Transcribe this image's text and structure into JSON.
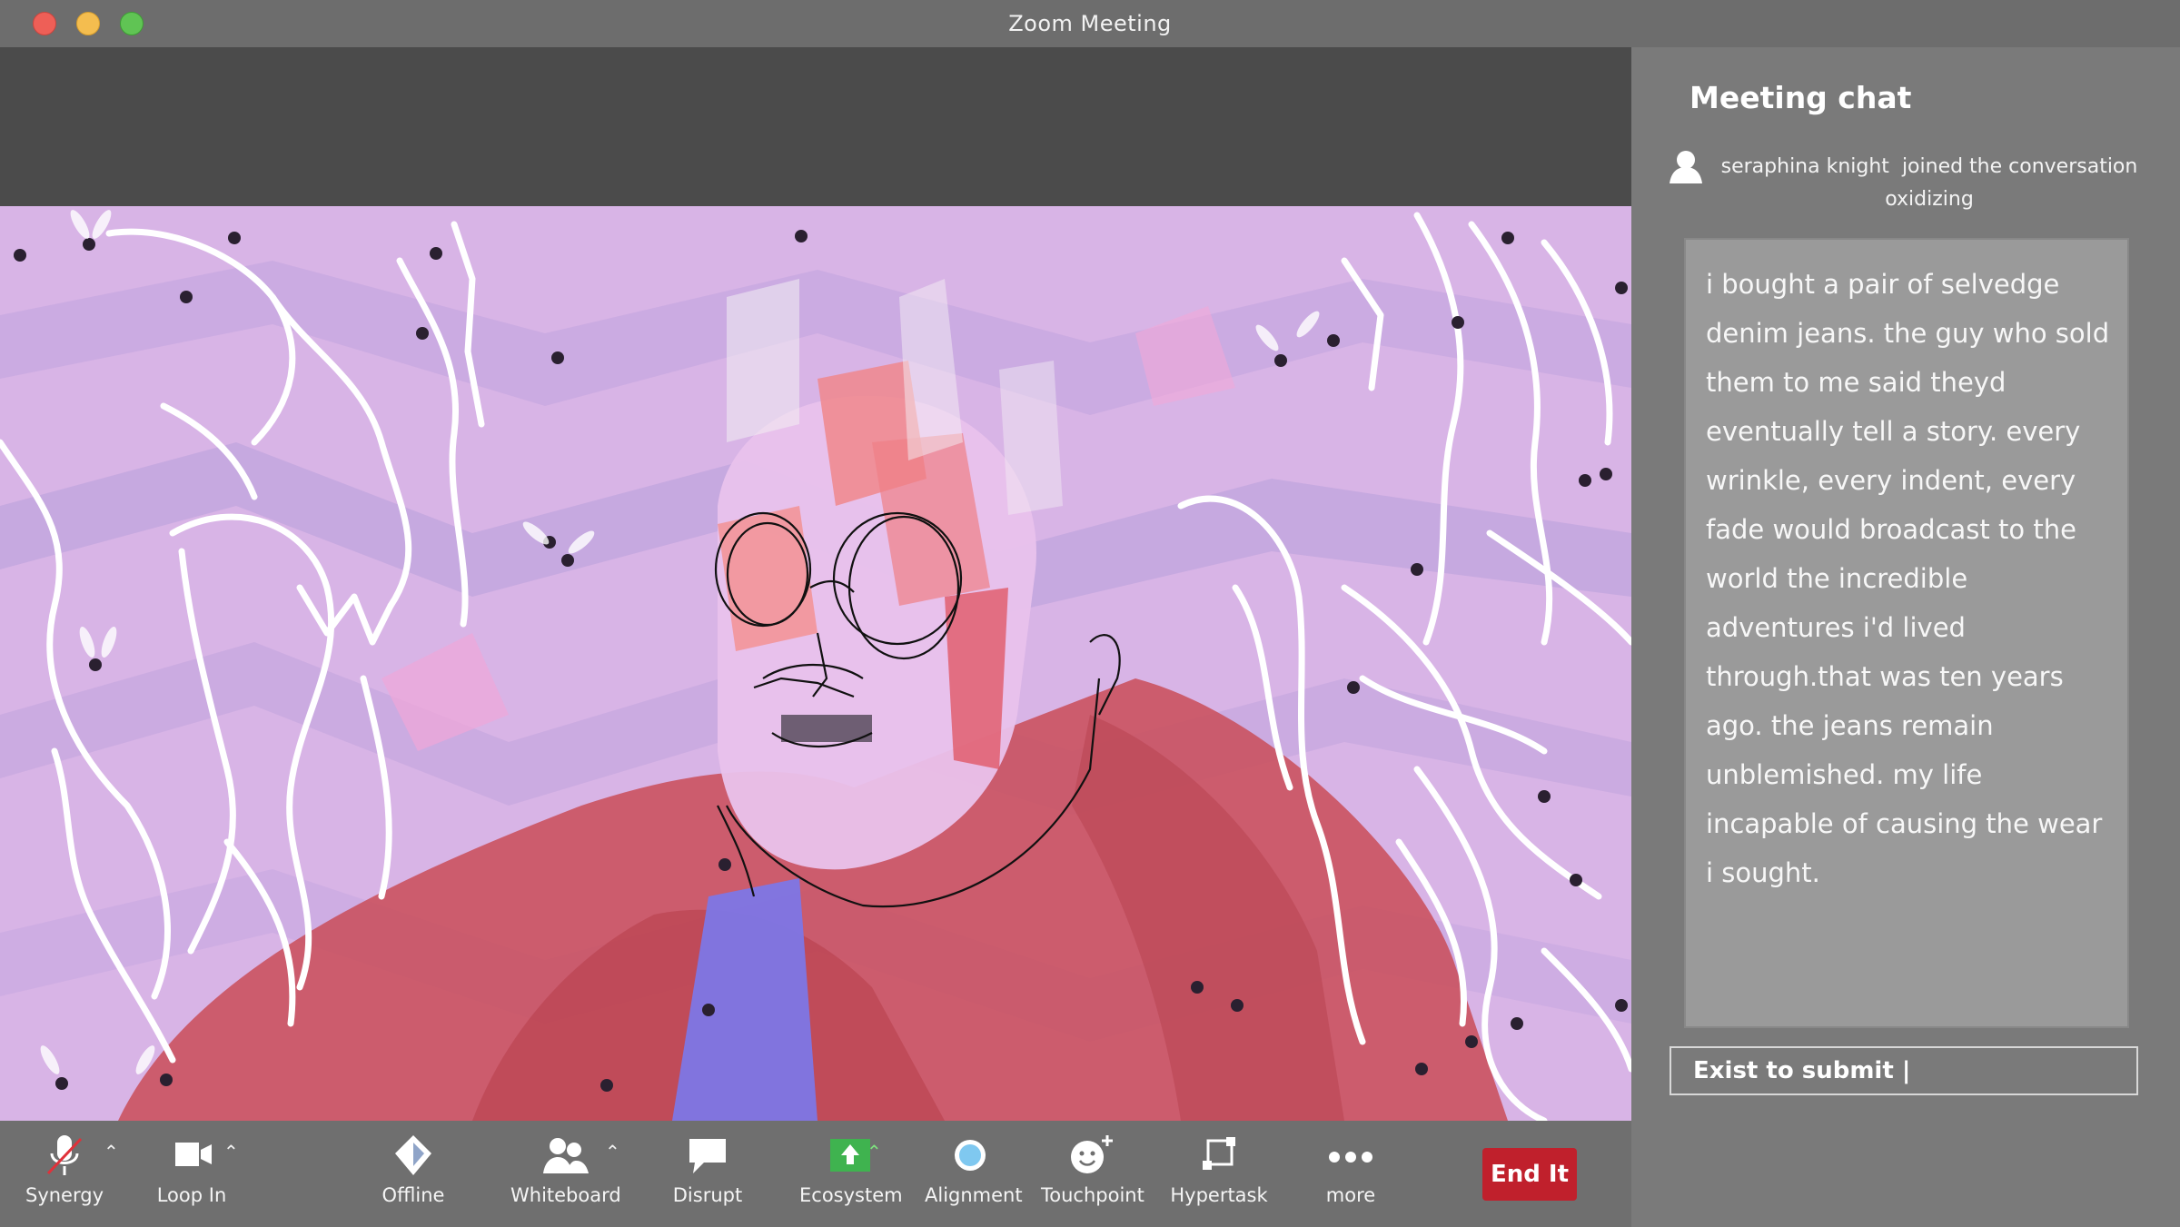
{
  "window": {
    "title": "Zoom Meeting"
  },
  "chat": {
    "title": "Meeting chat",
    "join_notice": {
      "name": "seraphina knight",
      "action": "joined the conversation",
      "status": "oxidizing"
    },
    "message": "i bought a pair of selvedge denim jeans. the guy who sold them to me said theyd eventually tell a story. every wrinkle, every indent, every fade would broadcast to the world the incredible adventures i'd lived through.that was ten years ago. the jeans remain unblemished. my life incapable of causing the wear i sought.",
    "input_value": "Exist to submit |"
  },
  "toolbar": {
    "synergy": "Synergy",
    "loop_in": "Loop In",
    "offline": "Offline",
    "whiteboard": "Whiteboard",
    "disrupt": "Disrupt",
    "ecosystem": "Ecosystem",
    "alignment": "Alignment",
    "touchpoint": "Touchpoint",
    "hypertask": "Hypertask",
    "more": "more",
    "end": "End It"
  },
  "colors": {
    "end_button": "#c0202c",
    "ecosystem_icon": "#3fb34f",
    "video_background": "#d6b3e4"
  }
}
